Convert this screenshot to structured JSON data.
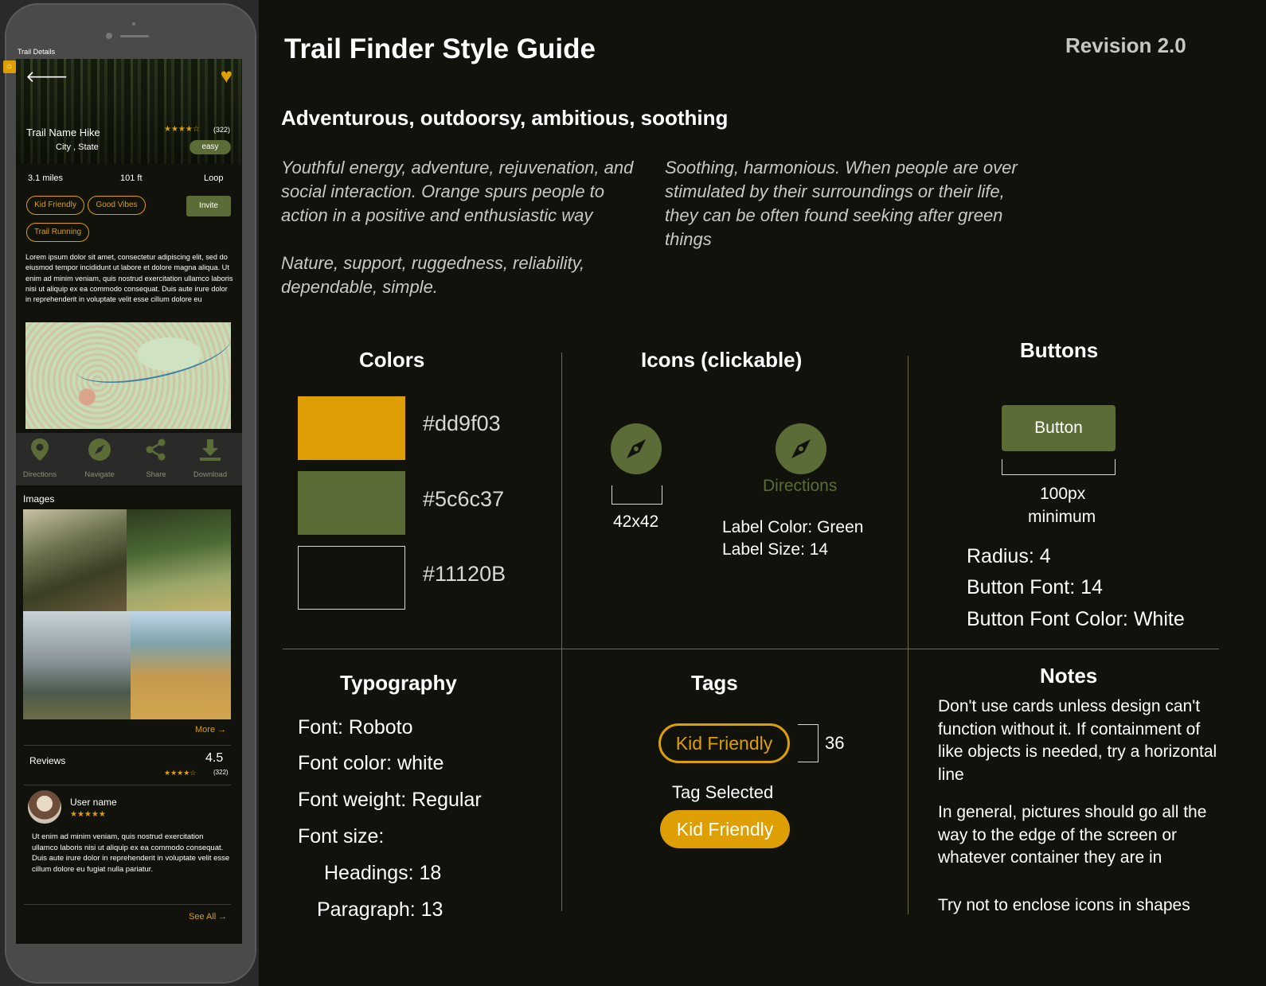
{
  "frame_label": "Trail Details",
  "phone": {
    "trail_name": "Trail Name Hike",
    "city_state": "City , State",
    "rating_stars": "★★★★☆",
    "rating_count": "(322)",
    "difficulty": "easy",
    "stats": {
      "distance": "3.1 miles",
      "elevation": "101 ft",
      "route": "Loop"
    },
    "tags": [
      "Kid Friendly",
      "Good Vibes",
      "Trail Running"
    ],
    "invite_label": "Invite",
    "description": "Lorem ipsum dolor sit amet, consectetur adipiscing elit, sed do eiusmod tempor incididunt ut labore et dolore magna aliqua. Ut enim ad minim veniam, quis nostrud exercitation ullamco laboris nisi ut aliquip ex ea commodo consequat. Duis aute irure dolor in reprehenderit in voluptate velit esse cillum dolore eu",
    "actions": [
      {
        "label": "Directions",
        "icon": "map-pin-icon"
      },
      {
        "label": "Navigate",
        "icon": "compass-icon"
      },
      {
        "label": "Share",
        "icon": "share-icon"
      },
      {
        "label": "Download",
        "icon": "download-icon"
      }
    ],
    "images_title": "Images",
    "more_label": "More →",
    "reviews_title": "Reviews",
    "reviews_score": "4.5",
    "reviews_stars": "★★★★☆",
    "reviews_count": "(322)",
    "user_name": "User name",
    "user_stars": "★★★★★",
    "review_text": "Ut enim ad minim veniam, quis nostrud exercitation ullamco laboris nisi ut aliquip ex ea commodo consequat. Duis aute irure dolor in reprehenderit in voluptate velit esse cillum dolore eu fugiat nulla pariatur.",
    "see_all_label": "See All →"
  },
  "guide": {
    "title": "Trail Finder Style Guide",
    "revision": "Revision 2.0",
    "subtitle": "Adventurous, outdoorsy, ambitious, soothing",
    "orange_desc": "Youthful energy, adventure, rejuvenation, and social interaction. Orange spurs people to action in a positive and enthusiastic way",
    "brown_desc": "Nature, support, ruggedness, reliability, dependable, simple.",
    "green_desc": "Soothing, harmonious. When people are over stimulated by their surroundings or their life, they can be often found seeking after green things",
    "colors": {
      "heading": "Colors",
      "swatches": [
        "#dd9f03",
        "#5c6c37",
        "#11120B"
      ]
    },
    "icons": {
      "heading": "Icons (clickable)",
      "size_label": "42x42",
      "icon_label": "Directions",
      "label_color": "Label Color: Green",
      "label_size": "Label Size: 14"
    },
    "buttons": {
      "heading": "Buttons",
      "button_label": "Button",
      "min_width_line1": "100px",
      "min_width_line2": "minimum",
      "radius": "Radius: 4",
      "font": "Button Font: 14",
      "font_color": "Button Font Color: White"
    },
    "typography": {
      "heading": "Typography",
      "font": "Font: Roboto",
      "color": "Font color: white",
      "weight": "Font weight: Regular",
      "size": "Font size:",
      "headings": "Headings: 18",
      "paragraph": "Paragraph: 13"
    },
    "tags": {
      "heading": "Tags",
      "tag_label": "Kid Friendly",
      "height_label": "36",
      "selected_label": "Tag Selected",
      "selected_tag_label": "Kid Friendly"
    },
    "notes": {
      "heading": "Notes",
      "note1": "Don't use cards unless design can't function without it. If containment of like objects is needed, try a horizontal line",
      "note2": "In general, pictures should go all the way to the edge of the screen or whatever container they are in",
      "note3": "Try not to enclose icons in shapes"
    }
  }
}
